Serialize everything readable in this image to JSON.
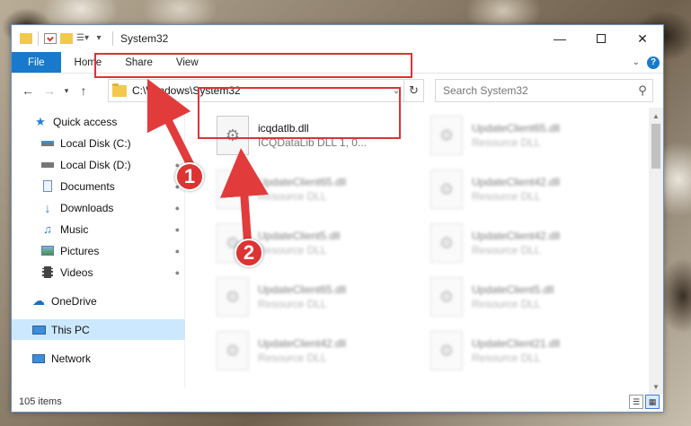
{
  "window": {
    "title": "System32"
  },
  "ribbon": {
    "tabs": [
      "File",
      "Home",
      "Share",
      "View"
    ]
  },
  "address": {
    "path": "C:\\Windows\\System32"
  },
  "search": {
    "placeholder": "Search System32"
  },
  "sidebar": {
    "items": [
      {
        "label": "Quick access",
        "icon": "star-icon",
        "pinned": false
      },
      {
        "label": "Local Disk (C:)",
        "icon": "drive-icon",
        "pinned": true
      },
      {
        "label": "Local Disk (D:)",
        "icon": "drive-icon",
        "pinned": true
      },
      {
        "label": "Documents",
        "icon": "document-icon",
        "pinned": true
      },
      {
        "label": "Downloads",
        "icon": "download-icon",
        "pinned": true
      },
      {
        "label": "Music",
        "icon": "music-icon",
        "pinned": true
      },
      {
        "label": "Pictures",
        "icon": "picture-icon",
        "pinned": true
      },
      {
        "label": "Videos",
        "icon": "video-icon",
        "pinned": true
      },
      {
        "label": "OneDrive",
        "icon": "cloud-icon",
        "pinned": false
      },
      {
        "label": "This PC",
        "icon": "computer-icon",
        "pinned": false
      },
      {
        "label": "Network",
        "icon": "network-icon",
        "pinned": false
      }
    ]
  },
  "files": [
    {
      "name": "icqdatlb.dll",
      "desc": "ICQDataLib DLL 1, 0...",
      "highlight": true
    },
    {
      "name": "UpdateClient65.dll",
      "desc": "Resource DLL"
    },
    {
      "name": "UpdateClient65.dll",
      "desc": "Resource DLL"
    },
    {
      "name": "UpdateClient42.dll",
      "desc": "Resource DLL"
    },
    {
      "name": "UpdateClient5.dll",
      "desc": "Resource DLL"
    },
    {
      "name": "UpdateClient42.dll",
      "desc": "Resource DLL"
    },
    {
      "name": "UpdateClient65.dll",
      "desc": "Resource DLL"
    },
    {
      "name": "UpdateClient5.dll",
      "desc": "Resource DLL"
    },
    {
      "name": "UpdateClient42.dll",
      "desc": "Resource DLL"
    },
    {
      "name": "UpdateClient21.dll",
      "desc": "Resource DLL"
    }
  ],
  "status": {
    "item_count": "105 items"
  },
  "callouts": {
    "one": "1",
    "two": "2"
  },
  "colors": {
    "accent": "#1979ca",
    "highlight": "#dd3333",
    "selected": "#cce8ff"
  }
}
